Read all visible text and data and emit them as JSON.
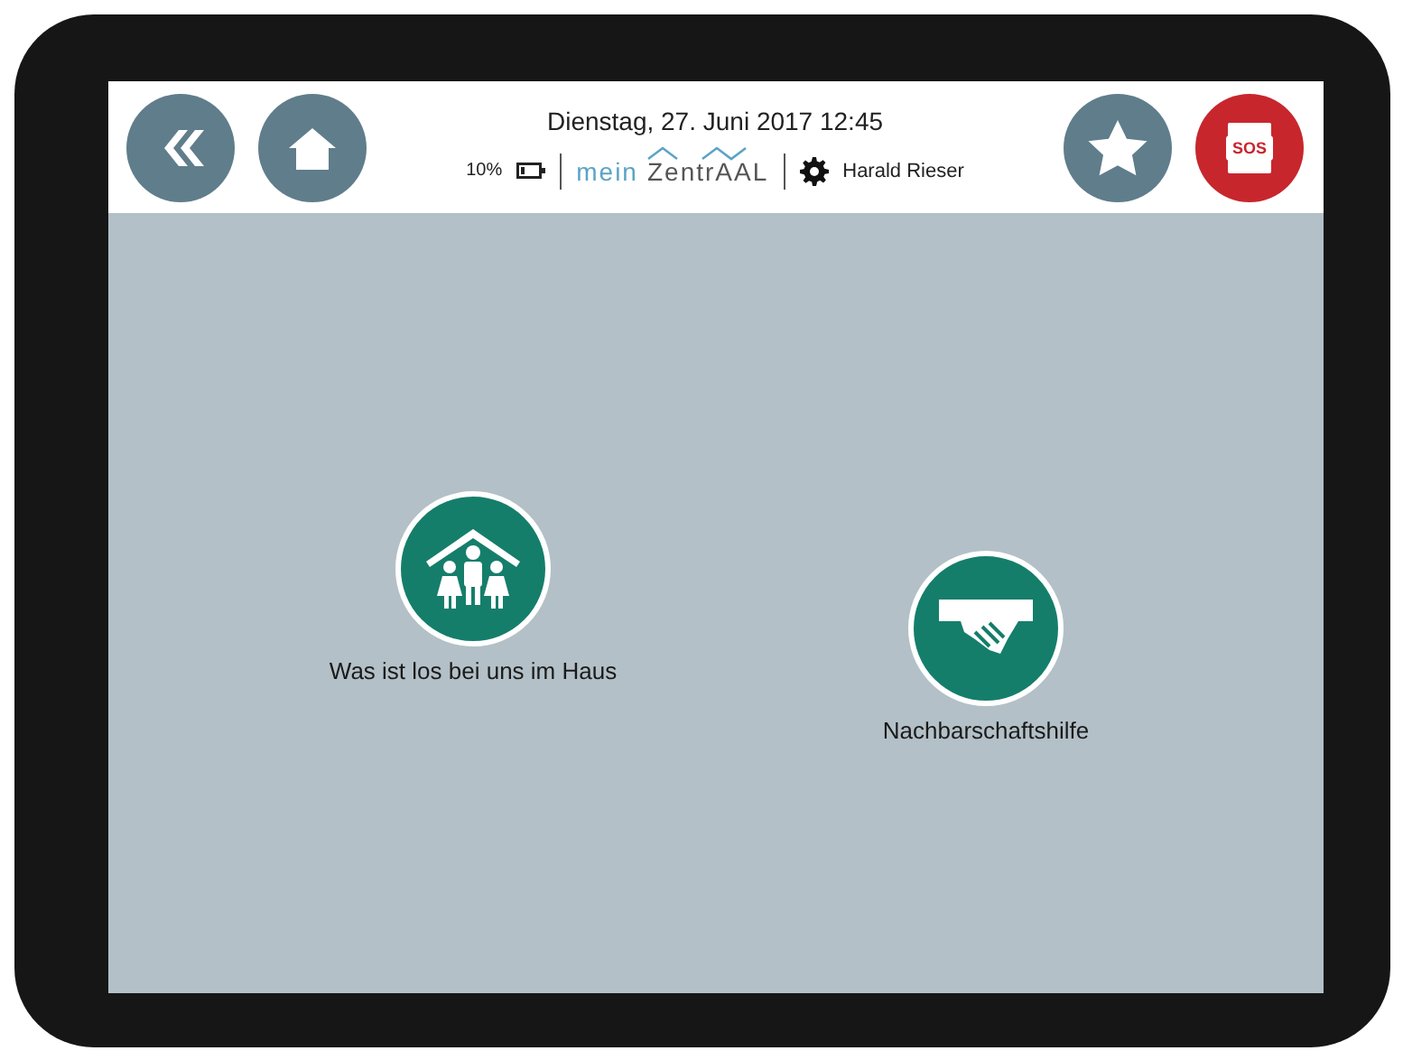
{
  "header": {
    "back_button": {
      "kind": "back"
    },
    "home_button": {
      "kind": "home"
    },
    "datetime": "Dienstag, 27. Juni 2017 12:45",
    "battery": "10%",
    "logo": {
      "part_1": "mein",
      "part_2": "ZentrAAL"
    },
    "user": "Harald Rieser",
    "favorites_button": {
      "kind": "star"
    },
    "sos_button": {
      "label": "SOS"
    }
  },
  "tiles": [
    {
      "kind": "family",
      "label": "Was ist los bei uns im Haus"
    },
    {
      "kind": "handshake",
      "label": "Nachbarschaftshilfe"
    }
  ]
}
